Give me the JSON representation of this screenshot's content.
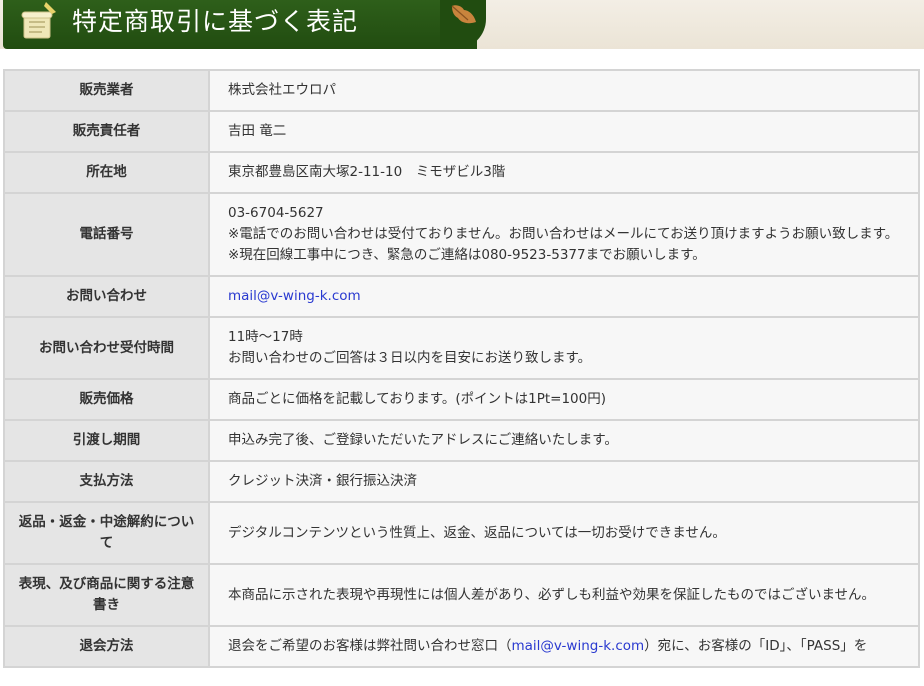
{
  "header": {
    "title": "特定商取引に基づく表記",
    "icon": "scroll-icon",
    "decoration": "leaf-icon",
    "accent_color": "#2e5f1a"
  },
  "rows": [
    {
      "label": "販売業者",
      "value": "株式会社エウロパ"
    },
    {
      "label": "販売責任者",
      "value": "吉田 竜二"
    },
    {
      "label": "所在地",
      "value": "東京都豊島区南大塚2-11-10　ミモザビル3階"
    },
    {
      "label": "電話番号",
      "lines": [
        "03-6704-5627",
        "※電話でのお問い合わせは受付ておりません。お問い合わせはメールにてお送り頂けますようお願い致します。",
        "※現在回線工事中につき、緊急のご連絡は080-9523-5377までお願いします。"
      ]
    },
    {
      "label": "お問い合わせ",
      "email": "mail@v-wing-k.com"
    },
    {
      "label": "お問い合わせ受付時間",
      "lines": [
        "11時～17時",
        "お問い合わせのご回答は３日以内を目安にお送り致します。"
      ]
    },
    {
      "label": "販売価格",
      "value": "商品ごとに価格を記載しております。(ポイントは1Pt=100円)"
    },
    {
      "label": "引渡し期間",
      "value": "申込み完了後、ご登録いただいたアドレスにご連絡いたします。"
    },
    {
      "label": "支払方法",
      "value": "クレジット決済・銀行振込決済"
    },
    {
      "label": "返品・返金・中途解約について",
      "value": "デジタルコンテンツという性質上、返金、返品については一切お受けできません。"
    },
    {
      "label": "表現、及び商品に関する注意書き",
      "value": "本商品に示された表現や再現性には個人差があり、必ずしも利益や効果を保証したものではございません。"
    },
    {
      "label": "退会方法",
      "pre": "退会をご希望のお客様は弊社問い合わせ窓口（",
      "email": "mail@v-wing-k.com",
      "post": "）宛に、お客様の「ID」、「PASS」を"
    }
  ]
}
